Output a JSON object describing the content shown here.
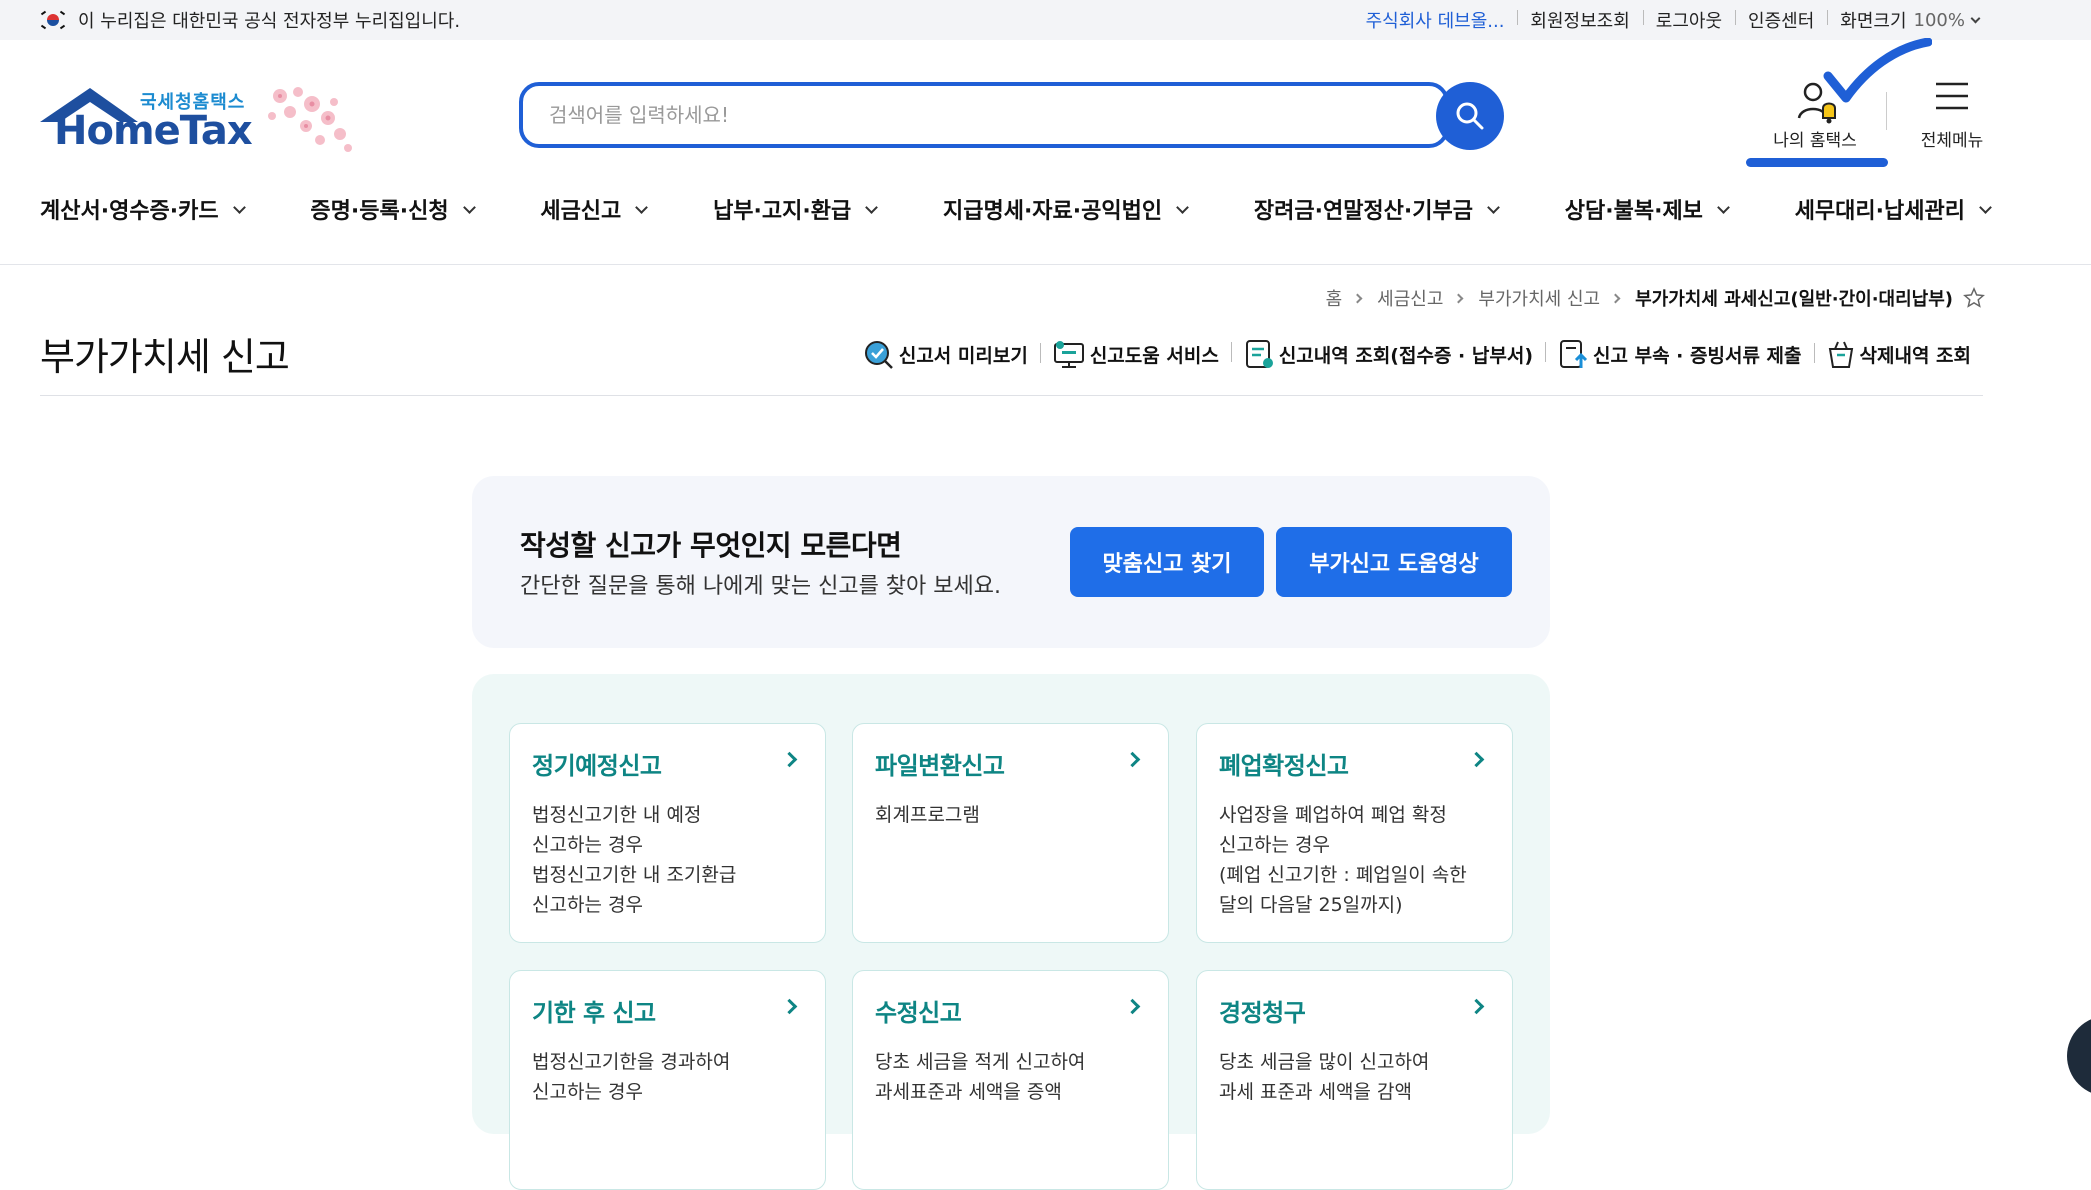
{
  "govbar": {
    "notice": "이 누리집은 대한민국 공식 전자정부 누리집입니다.",
    "links": [
      "주식회사 데브올...",
      "회원정보조회",
      "로그아웃",
      "인증센터"
    ],
    "zoom_label": "화면크기",
    "zoom_value": "100%"
  },
  "header": {
    "logo_sub": "국세청홈택스",
    "logo_main": "HomeTax",
    "search_placeholder": "검색어를 입력하세요!",
    "my_hometax": "나의 홈택스",
    "all_menu": "전체메뉴"
  },
  "gnb": [
    "계산서·영수증·카드",
    "증명·등록·신청",
    "세금신고",
    "납부·고지·환급",
    "지급명세·자료·공익법인",
    "장려금·연말정산·기부금",
    "상담·불복·제보",
    "세무대리·납세관리"
  ],
  "breadcrumb": [
    "홈",
    "세금신고",
    "부가가치세 신고",
    "부가가치세 과세신고(일반·간이·대리납부)"
  ],
  "page_title": "부가가치세 신고",
  "quick_links": [
    "신고서 미리보기",
    "신고도움 서비스",
    "신고내역 조회(접수증 · 납부서)",
    "신고 부속 · 증빙서류 제출",
    "삭제내역 조회"
  ],
  "guide": {
    "heading": "작성할 신고가 무엇인지 모른다면",
    "text": "간단한 질문을 통해 나에게 맞는 신고를 찾아 보세요.",
    "btn_find": "맞춤신고 찾기",
    "btn_video": "부가신고 도움영상"
  },
  "cards": [
    {
      "title": "정기예정신고",
      "lines": [
        "법정신고기한 내 예정",
        "신고하는 경우",
        "법정신고기한 내 조기환급",
        "신고하는 경우"
      ]
    },
    {
      "title": "파일변환신고",
      "lines": [
        "회계프로그램"
      ]
    },
    {
      "title": "폐업확정신고",
      "lines": [
        "사업장을 폐업하여 폐업 확정",
        "신고하는 경우",
        "(폐업 신고기한 : 폐업일이 속한",
        "달의 다음달 25일까지)"
      ]
    },
    {
      "title": "기한 후 신고",
      "lines": [
        "법정신고기한을 경과하여",
        "신고하는 경우"
      ]
    },
    {
      "title": "수정신고",
      "lines": [
        "당초 세금을 적게 신고하여",
        "과세표준과 세액을 증액"
      ]
    },
    {
      "title": "경정청구",
      "lines": [
        "당초 세금을 많이 신고하여",
        "과세 표준과 세액을 감액"
      ]
    }
  ],
  "colors": {
    "primary": "#1f5fd6",
    "teal": "#0e8584",
    "button": "#1f6ee8"
  }
}
